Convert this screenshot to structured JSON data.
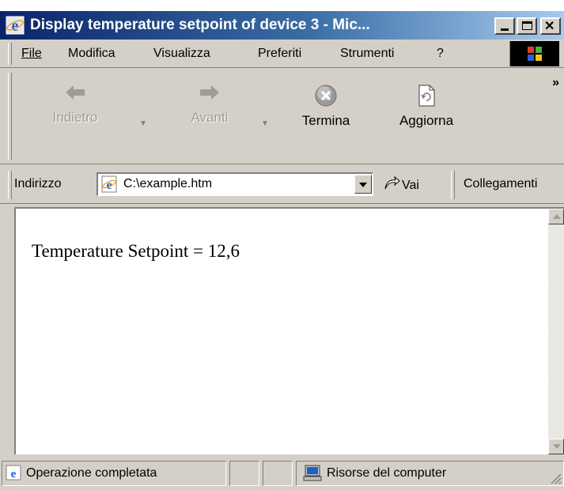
{
  "window": {
    "title": "Display temperature setpoint of device 3 - Mic..."
  },
  "menu": {
    "items": [
      {
        "label": "File"
      },
      {
        "label": "Modifica"
      },
      {
        "label": "Visualizza"
      },
      {
        "label": "Preferiti"
      },
      {
        "label": "Strumenti"
      },
      {
        "label": "?"
      }
    ]
  },
  "toolbar": {
    "back_label": "Indietro",
    "forward_label": "Avanti",
    "stop_label": "Termina",
    "refresh_label": "Aggiorna",
    "overflow": "»"
  },
  "address": {
    "label": "Indirizzo",
    "value": "C:\\example.htm",
    "go_label": "Vai",
    "links_label": "Collegamenti"
  },
  "content": {
    "text": "Temperature Setpoint = 12,6"
  },
  "status": {
    "message": "Operazione completata",
    "zone": "Risorse del computer"
  },
  "colors": {
    "titlebar_start": "#0a246a",
    "titlebar_end": "#a6caf0",
    "chrome": "#d4d0c8"
  }
}
